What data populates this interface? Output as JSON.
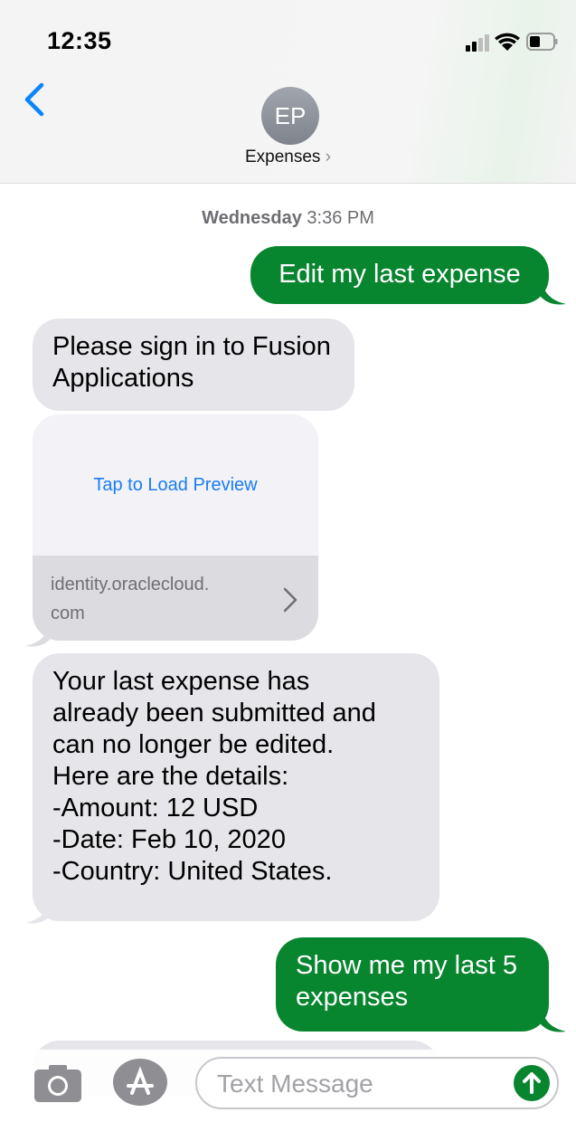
{
  "status_bar": {
    "time": "12:35",
    "icons": [
      "signal-icon",
      "wifi-icon",
      "battery-icon"
    ]
  },
  "header": {
    "back_icon": "chevron-left-icon",
    "avatar_initials": "EP",
    "contact_name": "Expenses",
    "contact_chevron": "›"
  },
  "thread": {
    "timestamp_day": "Wednesday",
    "timestamp_time": "3:36 PM",
    "messages": [
      {
        "direction": "outgoing",
        "text": "Edit my last expense"
      },
      {
        "direction": "incoming",
        "lines": [
          "Please sign in to Fusion",
          "Applications"
        ]
      },
      {
        "direction": "incoming",
        "lines": [
          "Your last expense has",
          "already been submitted and",
          "can no longer be edited.",
          "Here are the details:",
          "-Amount: 12 USD",
          "-Date: Feb 10, 2020",
          "-Country: United States."
        ]
      },
      {
        "direction": "outgoing",
        "lines": [
          "Show me my last 5",
          "expenses"
        ]
      }
    ],
    "link_preview": {
      "tap_text": "Tap to Load Preview",
      "domain_lines": [
        "identity.oraclecloud.",
        "com"
      ]
    }
  },
  "composer": {
    "placeholder": "Text Message",
    "icons": [
      "camera-icon",
      "app-store-icon",
      "send-arrow-icon"
    ]
  },
  "colors": {
    "outgoing_bubble": "#08852f",
    "incoming_bubble": "#e5e5ea",
    "accent_blue": "#1a7cf5",
    "link_text": "#1a7cf5"
  }
}
